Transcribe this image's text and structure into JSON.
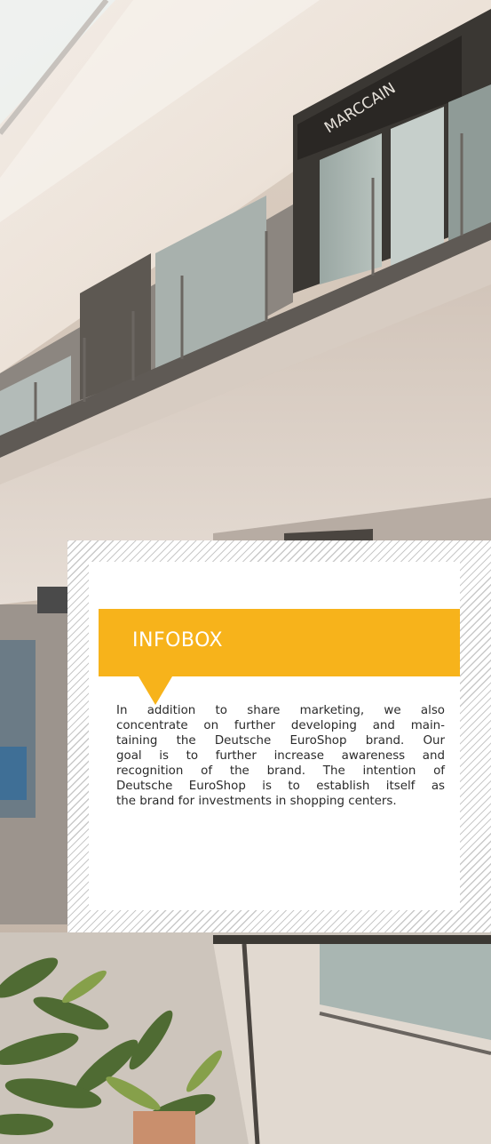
{
  "photo": {
    "store_sign": "MARCCAIN"
  },
  "infobox": {
    "title": "INFOBOX",
    "lines": [
      "In addition to share marketing, we also",
      "concentrate on further developing and main-",
      "taining the Deutsche EuroShop brand. Our",
      "goal is to further increase awareness and",
      "recognition of the brand. The intention of",
      "Deutsche EuroShop is to establish itself as",
      "the brand for investments in shopping centers."
    ]
  },
  "colors": {
    "accent": "#f7b31b",
    "text": "#2a2a2a",
    "title_text": "#ffffff"
  }
}
